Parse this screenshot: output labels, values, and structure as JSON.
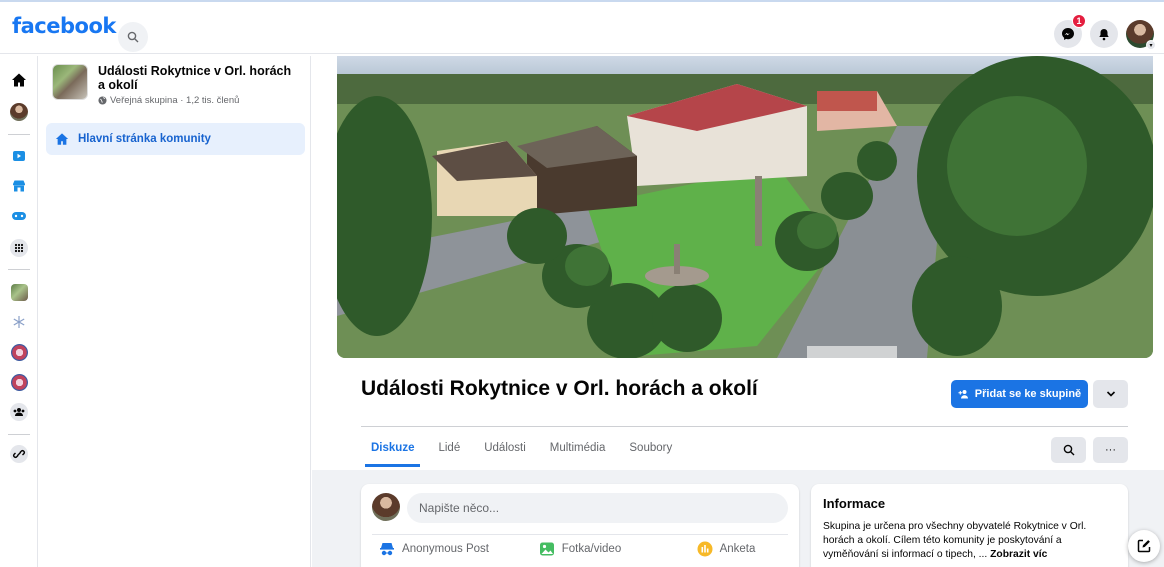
{
  "app": {
    "logo": "facebook"
  },
  "topbar": {
    "messenger_badge": "1"
  },
  "sidebar": {
    "group_name": "Události Rokytnice v Orl. horách a okolí",
    "group_meta": "Veřejná skupina · 1,2 tis. členů",
    "active_item": "Hlavní stránka komunity"
  },
  "group": {
    "title": "Události Rokytnice v Orl. horách a okolí",
    "join_label": "Přidat se ke skupině"
  },
  "tabs": [
    {
      "label": "Diskuze",
      "active": true
    },
    {
      "label": "Lidé",
      "active": false
    },
    {
      "label": "Události",
      "active": false
    },
    {
      "label": "Multimédia",
      "active": false
    },
    {
      "label": "Soubory",
      "active": false
    }
  ],
  "composer": {
    "placeholder": "Napište něco...",
    "actions": [
      {
        "label": "Anonymous Post",
        "icon": "anonymous-icon"
      },
      {
        "label": "Fotka/video",
        "icon": "photo-icon"
      },
      {
        "label": "Anketa",
        "icon": "poll-icon"
      }
    ]
  },
  "info": {
    "title": "Informace",
    "text": "Skupina je určena pro všechny obyvatelé Rokytnice v Orl. horách a okolí. Cílem této komunity je poskytování a vyměňování si informací o tipech, ...",
    "more": "Zobrazit víc"
  },
  "colors": {
    "brand": "#1877f2",
    "accent": "#1b74e4",
    "badge": "#e41e3f"
  }
}
